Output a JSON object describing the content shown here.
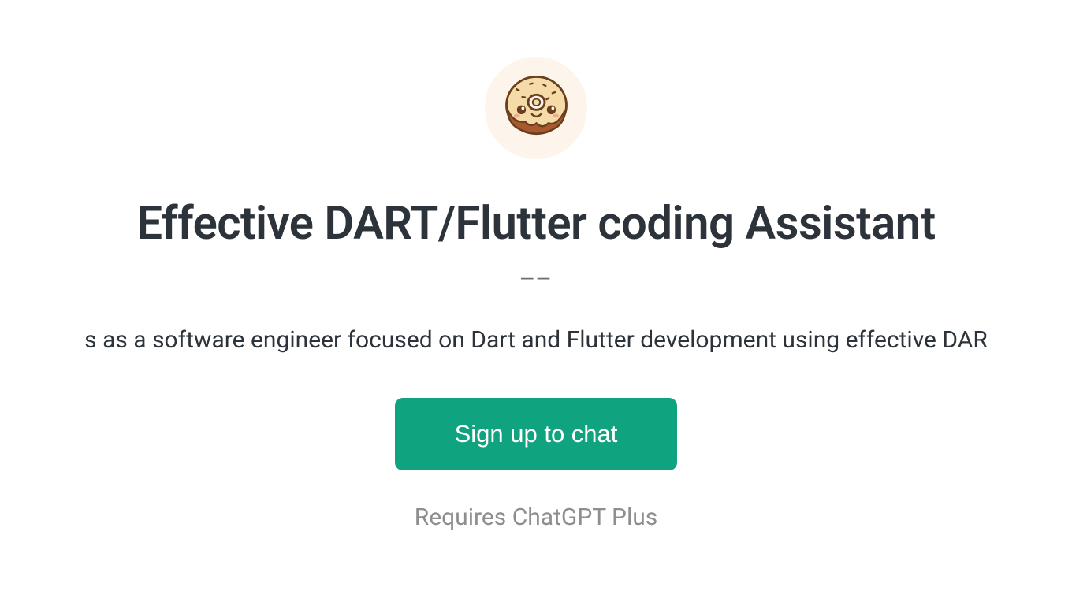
{
  "avatar": {
    "name": "donut-icon"
  },
  "title": "Effective DART/Flutter coding Assistant",
  "divider": "——",
  "description": "s as a software engineer focused on Dart and Flutter development using effective DAR",
  "button": {
    "label": "Sign up to chat"
  },
  "footer": {
    "text": "Requires ChatGPT Plus"
  }
}
